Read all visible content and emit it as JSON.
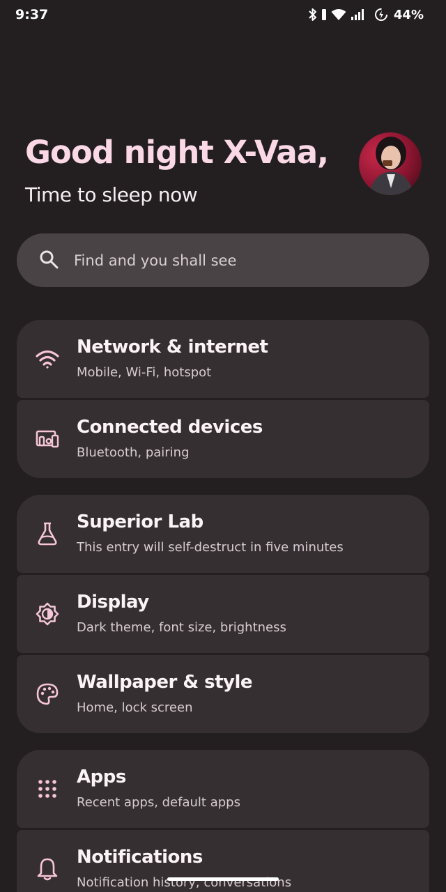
{
  "status": {
    "time": "9:37",
    "battery": "44%",
    "icons": [
      "bluetooth-icon",
      "vibrate-icon",
      "wifi-icon",
      "signal-icon",
      "battery-saver-icon"
    ]
  },
  "header": {
    "greeting": "Good night X-Vaa,",
    "subtitle": "Time to sleep now"
  },
  "search": {
    "placeholder": "Find and you shall see",
    "icon": "search-icon"
  },
  "groups": [
    {
      "items": [
        {
          "title": "Network & internet",
          "subtitle": "Mobile, Wi-Fi, hotspot",
          "icon": "wifi-icon"
        },
        {
          "title": "Connected devices",
          "subtitle": "Bluetooth, pairing",
          "icon": "devices-icon"
        }
      ]
    },
    {
      "items": [
        {
          "title": "Superior Lab",
          "subtitle": "This entry will self-destruct in five minutes",
          "icon": "flask-icon"
        },
        {
          "title": "Display",
          "subtitle": "Dark theme, font size, brightness",
          "icon": "brightness-icon"
        },
        {
          "title": "Wallpaper & style",
          "subtitle": "Home, lock screen",
          "icon": "palette-icon"
        }
      ]
    },
    {
      "items": [
        {
          "title": "Apps",
          "subtitle": "Recent apps, default apps",
          "icon": "apps-grid-icon"
        },
        {
          "title": "Notifications",
          "subtitle": "Notification history, conversations",
          "icon": "bell-icon"
        }
      ]
    }
  ],
  "colors": {
    "background": "#231f21",
    "greeting": "#fad8e5",
    "card": "#352f31",
    "search": "#4a4346",
    "icon_accent": "#f6c6d8"
  }
}
